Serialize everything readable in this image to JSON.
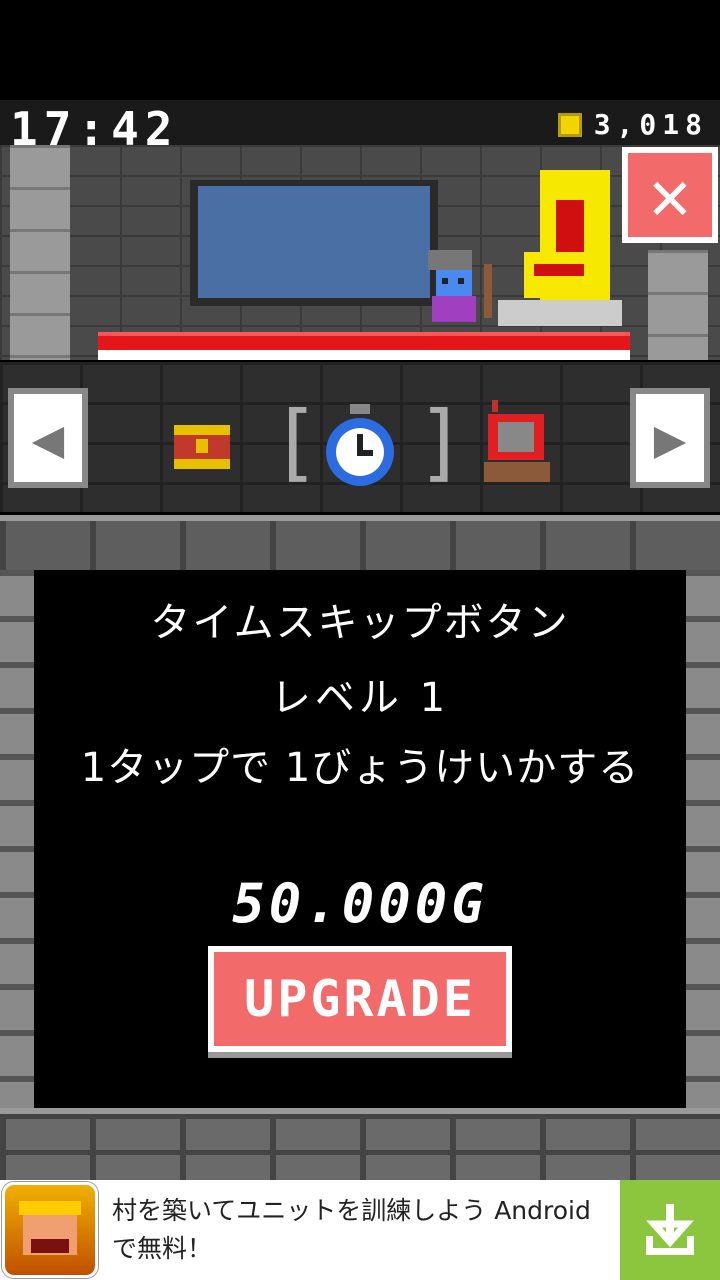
{
  "hud": {
    "clock": "17:42",
    "coins": "3,018"
  },
  "scene": {
    "close_label": "✕"
  },
  "itembar": {
    "prev_icon": "triangle-left-icon",
    "next_icon": "triangle-right-icon",
    "prev_label": "◀",
    "next_label": "▶",
    "items": [
      "treasure-chest-icon",
      "stopwatch-icon",
      "television-icon"
    ],
    "selected_index": 1,
    "bracket_left": "[",
    "bracket_right": "]"
  },
  "dialog": {
    "item_name": "タイムスキップボタン",
    "level": "レベル 1",
    "effect": "1タップで 1びょうけいかする",
    "price": "50.000G",
    "upgrade_label": "UPGRADE"
  },
  "ad": {
    "text": "村を築いてユニットを訓練しよう Androidで無料！",
    "icon": "clash-of-clans-app-icon",
    "download_icon": "download-icon"
  },
  "colors": {
    "accent_red": "#f36a6a",
    "floor_red": "#e2161b",
    "coin_yellow": "#f2d400",
    "ad_green": "#8cc63f"
  }
}
